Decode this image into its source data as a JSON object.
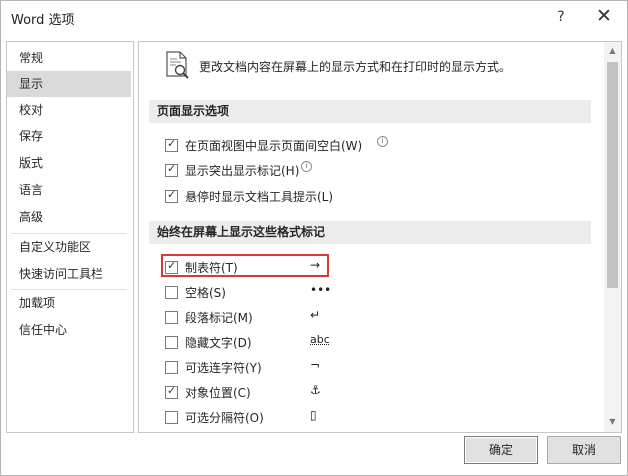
{
  "window": {
    "title": "Word 选项",
    "help": "?",
    "close": "✕"
  },
  "sidebar": {
    "items": [
      {
        "label": "常规"
      },
      {
        "label": "显示",
        "selected": true
      },
      {
        "label": "校对"
      },
      {
        "label": "保存"
      },
      {
        "label": "版式"
      },
      {
        "label": "语言"
      },
      {
        "label": "高级"
      },
      {
        "label": "自定义功能区"
      },
      {
        "label": "快速访问工具栏"
      },
      {
        "label": "加载项"
      },
      {
        "label": "信任中心"
      }
    ]
  },
  "main": {
    "description": "更改文档内容在屏幕上的显示方式和在打印时的显示方式。",
    "page_display": {
      "header": "页面显示选项",
      "options": [
        {
          "label": "在页面视图中显示页面间空白(W)",
          "checked": true,
          "info": true
        },
        {
          "label": "显示突出显示标记(H)",
          "checked": true,
          "info": true
        },
        {
          "label": "悬停时显示文档工具提示(L)",
          "checked": true,
          "info": false
        }
      ]
    },
    "format_marks": {
      "header": "始终在屏幕上显示这些格式标记",
      "options": [
        {
          "label": "制表符(T)",
          "checked": true,
          "symbol": "→",
          "highlighted": true
        },
        {
          "label": "空格(S)",
          "checked": false,
          "symbol": "•••"
        },
        {
          "label": "段落标记(M)",
          "checked": false,
          "symbol": "↵"
        },
        {
          "label": "隐藏文字(D)",
          "checked": false,
          "symbol": "abc"
        },
        {
          "label": "可选连字符(Y)",
          "checked": false,
          "symbol": "¬"
        },
        {
          "label": "对象位置(C)",
          "checked": true,
          "symbol": "⚓"
        },
        {
          "label": "可选分隔符(O)",
          "checked": false,
          "symbol": "▯"
        }
      ]
    }
  },
  "footer": {
    "ok_label": "确定",
    "cancel_label": "取消"
  },
  "colors": {
    "highlight": "#d9373a",
    "selected_nav": "#dadada",
    "section_header": "#ececec"
  }
}
